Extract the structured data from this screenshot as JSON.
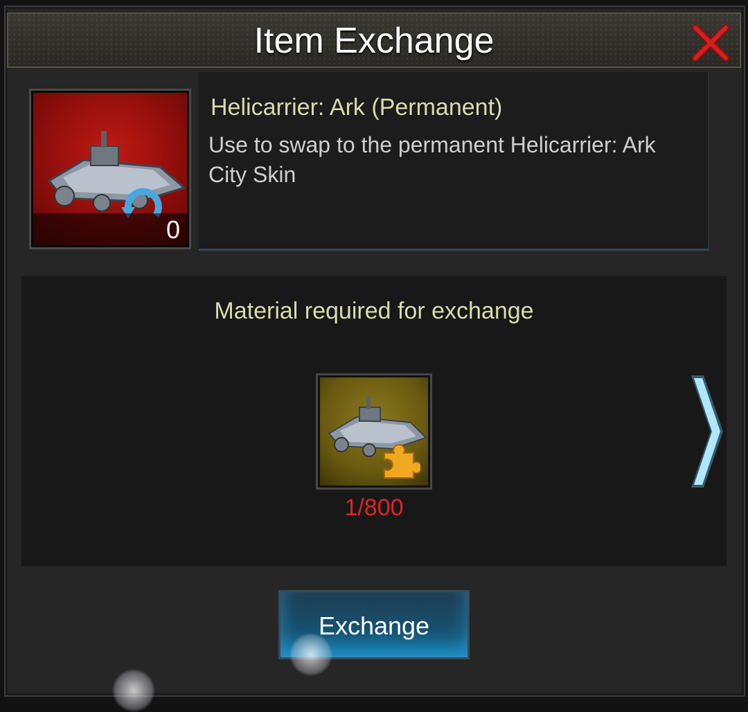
{
  "dialog": {
    "title": "Item Exchange"
  },
  "item": {
    "name": "Helicarrier: Ark (Permanent)",
    "description": "Use to swap to the permanent Helicarrier: Ark City Skin",
    "count": "0"
  },
  "material": {
    "heading": "Material required for exchange",
    "progress": "1/800"
  },
  "actions": {
    "exchange_label": "Exchange"
  },
  "colors": {
    "accent_text": "#d8dcae",
    "insufficient": "#e02424",
    "arrow": "#7fd8ff",
    "close": "#d42020"
  }
}
